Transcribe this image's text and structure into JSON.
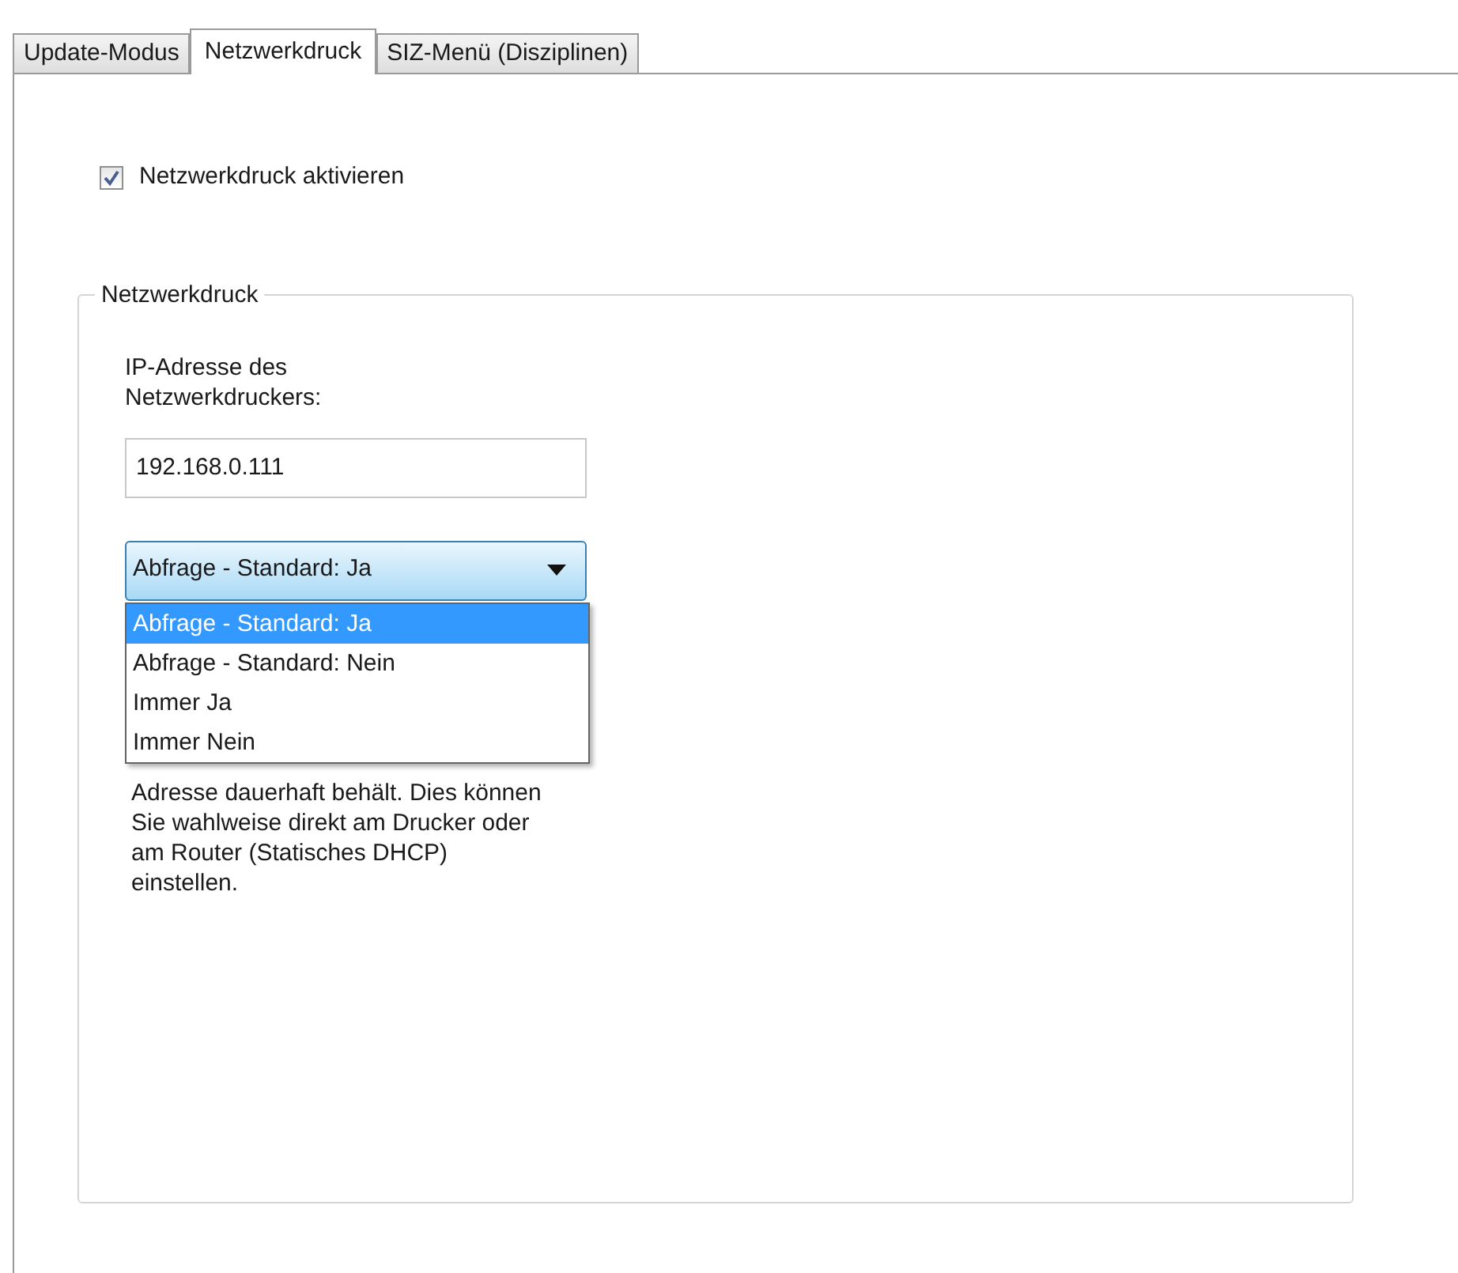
{
  "tabs": [
    {
      "label": "Update-Modus",
      "selected": false
    },
    {
      "label": "Netzwerkdruck",
      "selected": true
    },
    {
      "label": "SIZ-Menü (Disziplinen)",
      "selected": false
    }
  ],
  "enable_checkbox": {
    "label": "Netzwerkdruck aktivieren",
    "checked": true
  },
  "group": {
    "title": "Netzwerkdruck",
    "ip_label": "IP-Adresse des Netzwerkdruckers:",
    "ip_value": "192.168.0.111",
    "dropdown": {
      "value": "Abfrage - Standard: Ja",
      "expanded": true,
      "options": [
        {
          "label": "Abfrage - Standard: Ja",
          "selected": true
        },
        {
          "label": "Abfrage - Standard: Nein",
          "selected": false
        },
        {
          "label": "Immer Ja",
          "selected": false
        },
        {
          "label": "Immer Nein",
          "selected": false
        }
      ]
    },
    "description": "Adresse dauerhaft behält. Dies können Sie wahlweise direkt am Drucker oder am Router (Statisches DHCP) einstellen."
  }
}
